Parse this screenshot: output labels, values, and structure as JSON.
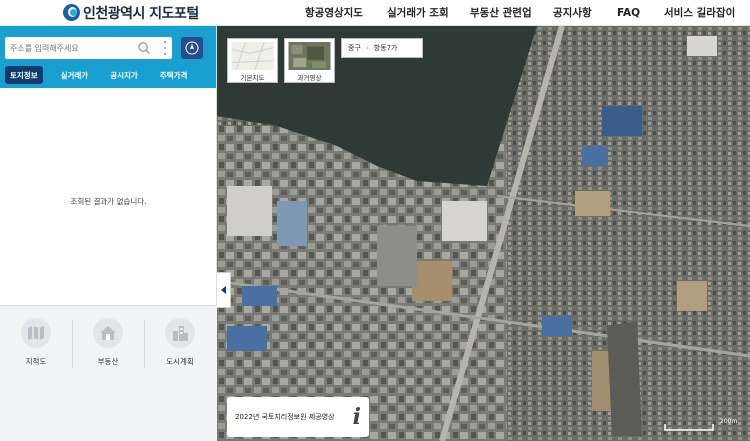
{
  "header": {
    "logo_text": "인천광역시 지도포털",
    "nav": [
      "항공영상지도",
      "실거래가 조회",
      "부동산 관련업",
      "공지사항",
      "FAQ",
      "서비스 길라잡이"
    ]
  },
  "sidebar": {
    "search_placeholder": "주소를 입력해주세요",
    "tabs": [
      "토지정보",
      "실거래가",
      "공시지가",
      "주택가격"
    ],
    "empty_message": "조회된 결과가 없습니다.",
    "bottom_menu": [
      "지적도",
      "부동산",
      "도시계획"
    ]
  },
  "map": {
    "basemaps": [
      "기본지도",
      "과거영상"
    ],
    "location": {
      "district": "중구",
      "dong": "항동7가"
    },
    "info_text": "2022년 국토지리정보원 제공영상",
    "info_icon": "i",
    "scale_label": "200m"
  },
  "colors": {
    "accent": "#1aa0d0",
    "active_tab": "#0f3b6e",
    "compass": "#2a4c8c",
    "water": "#2f3a36"
  },
  "icons": [
    "logo-icon",
    "search-icon",
    "more-vertical-icon",
    "compass-icon",
    "cadastral-map-icon",
    "house-icon",
    "buildings-icon",
    "collapse-arrow-icon",
    "info-icon",
    "chevron-right-icon"
  ]
}
